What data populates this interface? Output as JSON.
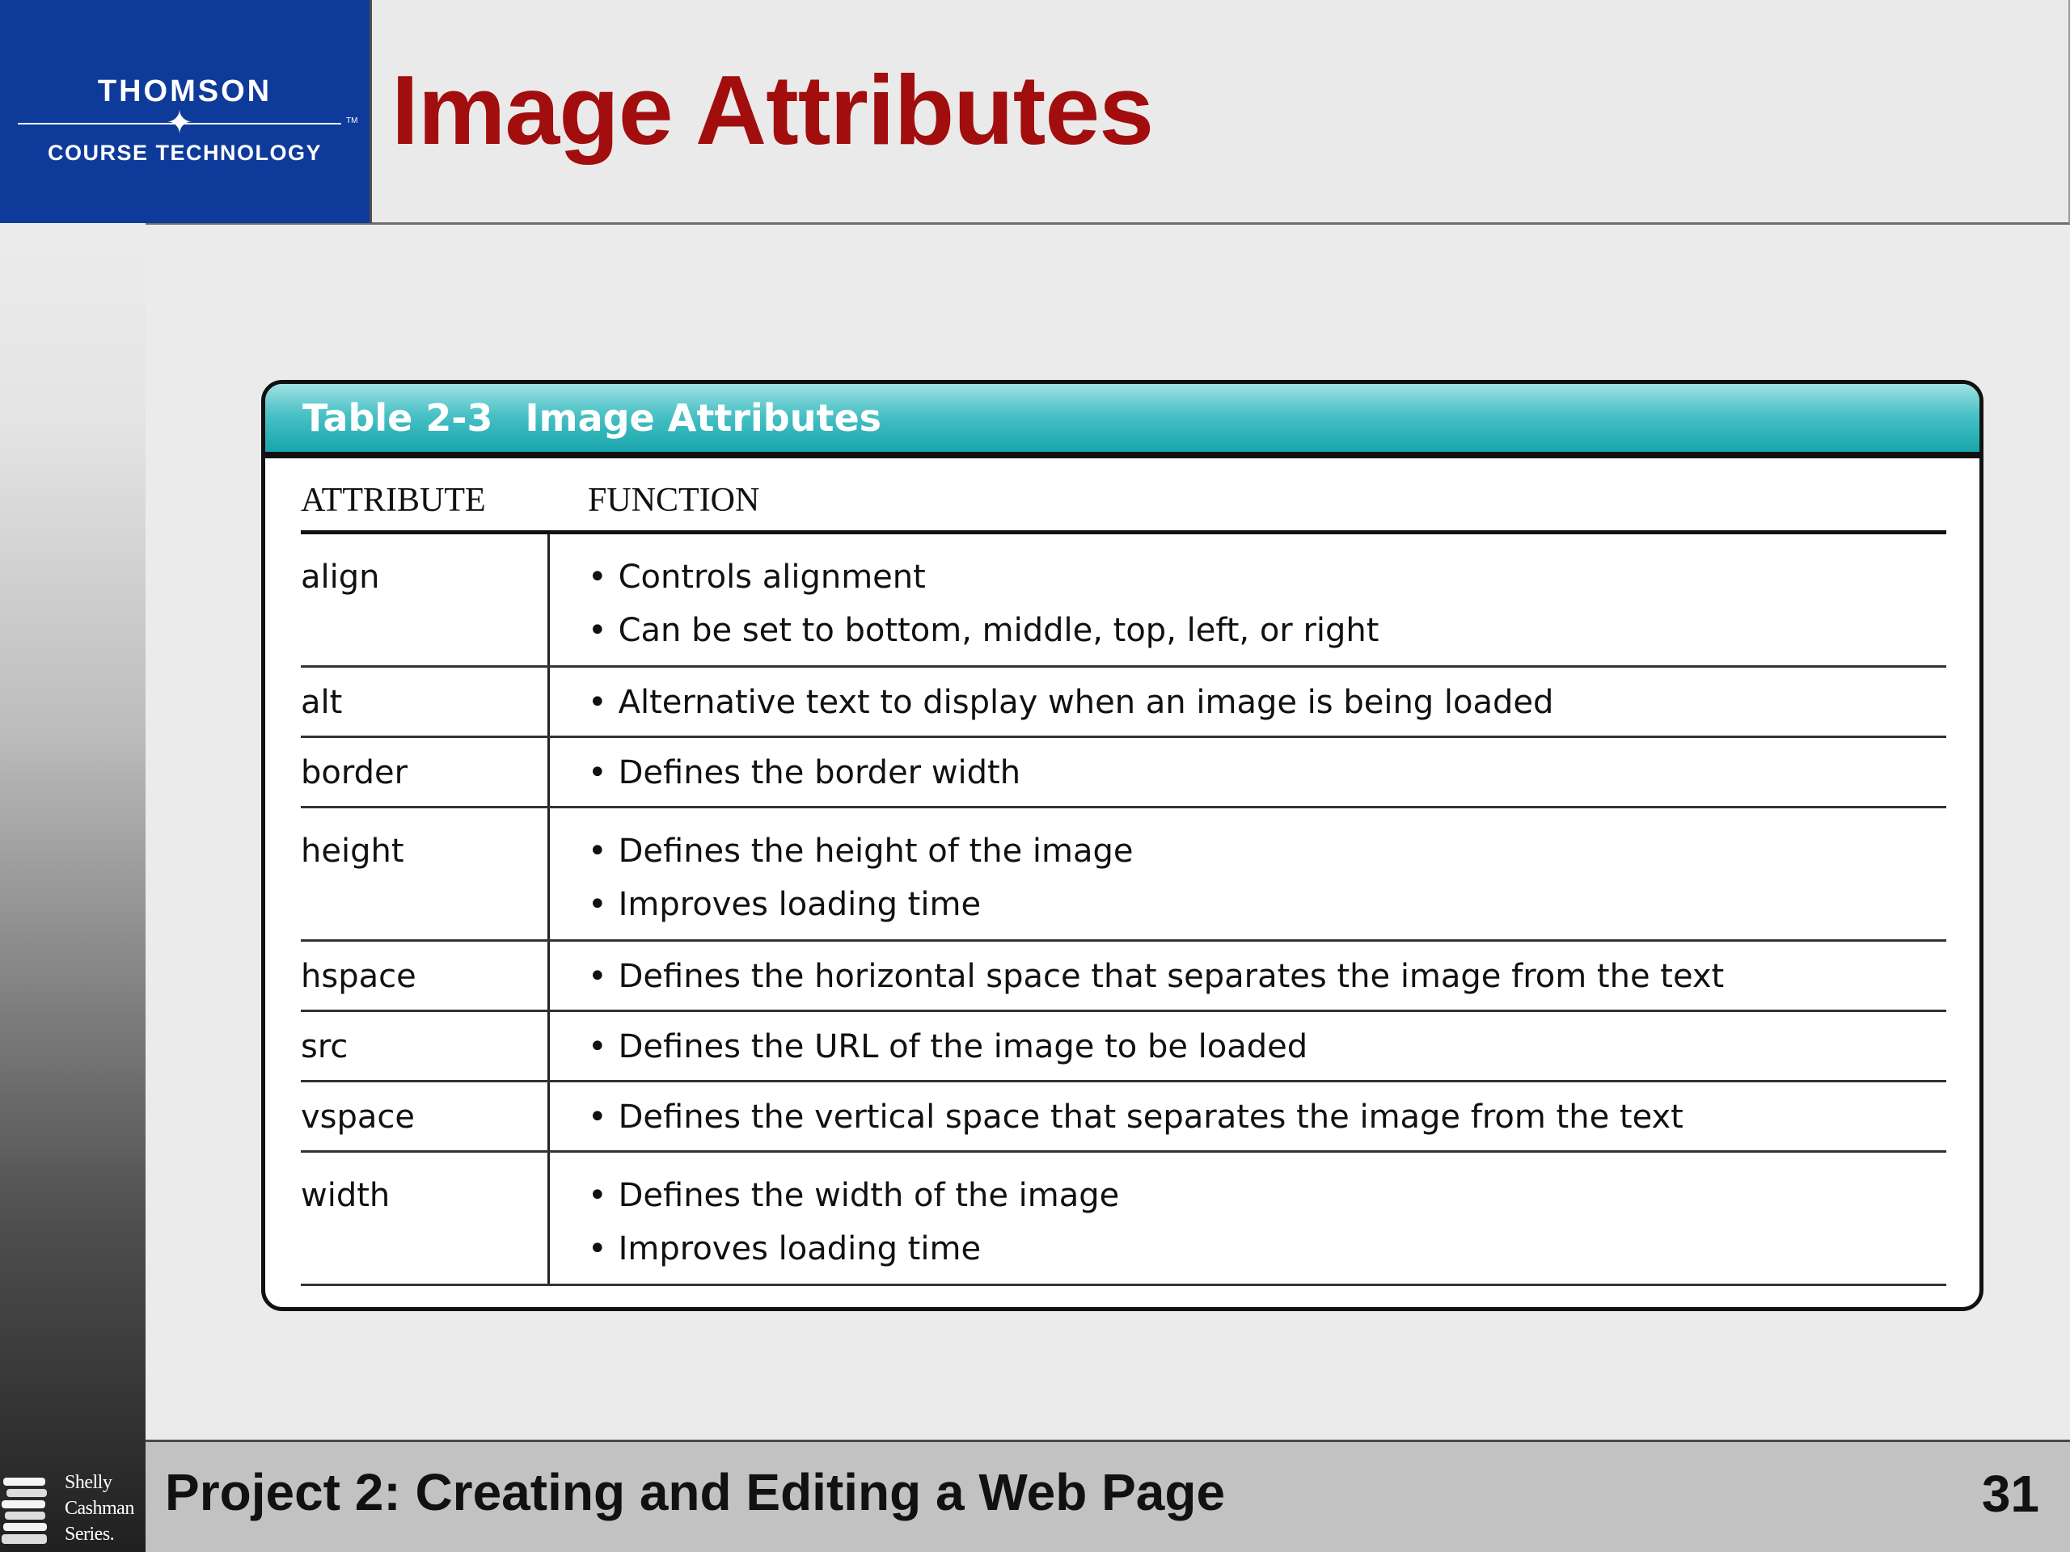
{
  "logo": {
    "top": "THOMSON",
    "bottom": "COURSE TECHNOLOGY",
    "tm": "TM"
  },
  "slide": {
    "title": "Image Attributes"
  },
  "table": {
    "caption_number": "Table 2-3",
    "caption_title": "Image Attributes",
    "headers": [
      "ATTRIBUTE",
      "FUNCTION"
    ],
    "rows": [
      {
        "attribute": "align",
        "functions": [
          "Controls alignment",
          "Can be set to bottom, middle, top, left, or right"
        ]
      },
      {
        "attribute": "alt",
        "functions": [
          "Alternative text to display when an image is being loaded"
        ]
      },
      {
        "attribute": "border",
        "functions": [
          "Defines the border width"
        ]
      },
      {
        "attribute": "height",
        "functions": [
          "Defines the height of the image",
          "Improves loading time"
        ]
      },
      {
        "attribute": "hspace",
        "functions": [
          "Defines the horizontal space that separates the image from the text"
        ]
      },
      {
        "attribute": "src",
        "functions": [
          "Defines the URL of the image to be loaded"
        ]
      },
      {
        "attribute": "vspace",
        "functions": [
          "Defines the vertical space that separates the image from the text"
        ]
      },
      {
        "attribute": "width",
        "functions": [
          "Defines the width of the image",
          "Improves loading time"
        ]
      }
    ]
  },
  "footer": {
    "title": "Project 2: Creating and Editing a Web Page",
    "page_number": "31",
    "series_lines": [
      "Shelly",
      "Cashman",
      "Series."
    ]
  },
  "colors": {
    "title_red": "#a20d0d",
    "logo_blue": "#0e3a9a",
    "caption_teal": "#2fb4b9"
  }
}
